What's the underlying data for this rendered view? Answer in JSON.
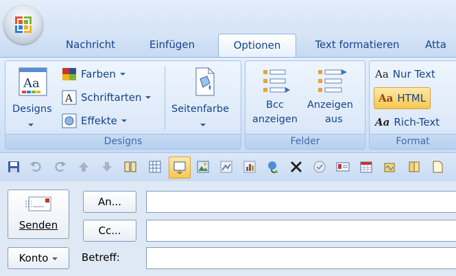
{
  "tabs": [
    {
      "label": "Nachricht",
      "active": false
    },
    {
      "label": "Einfügen",
      "active": false
    },
    {
      "label": "Optionen",
      "active": true
    },
    {
      "label": "Text formatieren",
      "active": false
    },
    {
      "label": "Atta",
      "active": false
    }
  ],
  "ribbon": {
    "designs": {
      "designs_label": "Designs",
      "farben": "Farben",
      "schriftarten": "Schriftarten",
      "effekte": "Effekte",
      "seitenfarbe": "Seitenfarbe",
      "group_label": "Designs"
    },
    "felder": {
      "bcc_line1": "Bcc",
      "bcc_line2": "anzeigen",
      "anzeigen_line1": "Anzeigen",
      "anzeigen_line2": "aus",
      "group_label": "Felder"
    },
    "format": {
      "nur_text": "Nur Text",
      "html": "HTML",
      "rich_text": "Rich-Text",
      "aa": "Aa",
      "group_label": "Format"
    }
  },
  "compose": {
    "senden": "Senden",
    "an": "An...",
    "cc": "Cc...",
    "konto": "Konto",
    "betreff": "Betreff:",
    "to_value": "",
    "cc_value": "",
    "subject_value": ""
  },
  "colors": {
    "ribbon_text": "#15428b",
    "html_active": "#fcd97e"
  }
}
